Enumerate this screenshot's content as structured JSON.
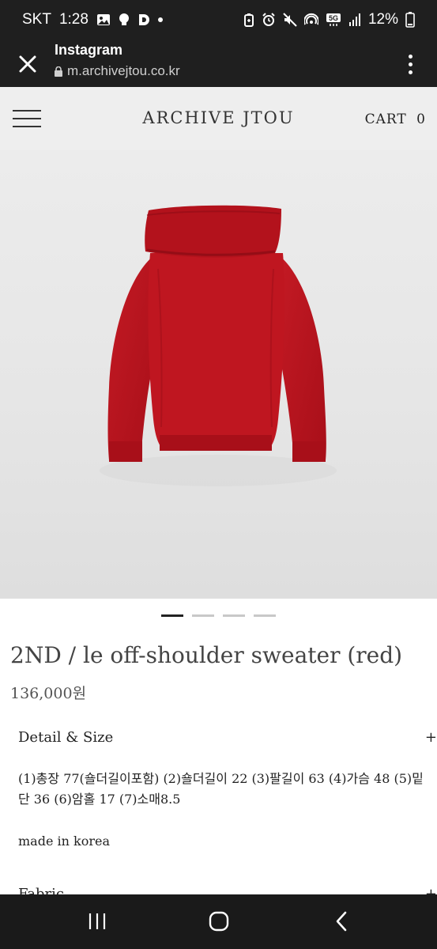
{
  "status_bar": {
    "carrier": "SKT",
    "time": "1:28",
    "notification_icons": [
      "gallery-icon",
      "bulb-icon",
      "d-app-icon",
      "more-dot-icon"
    ],
    "system_icons": [
      "battery-saver-icon",
      "alarm-icon",
      "mute-icon",
      "hotspot-icon",
      "5g-icon",
      "signal-icon"
    ],
    "network": "5G",
    "battery": "12%"
  },
  "browser": {
    "title": "Instagram",
    "url": "m.archivejtou.co.kr",
    "close_icon": "close-icon",
    "menu_icon": "more-vert-icon"
  },
  "site": {
    "logo": "ARCHIVE JTOU",
    "cart_label": "CART",
    "cart_count": "0"
  },
  "product": {
    "image_alt_color": "#b8141e",
    "carousel_count": 4,
    "carousel_active": 0,
    "title": "2ND / le off-shoulder sweater (red)",
    "price": "136,000원",
    "detail_heading": "Detail & Size",
    "detail_toggle": "+",
    "detail_line": "(1)총장 77(숄더길이포함) (2)숄더길이 22 (3)팔길이 63 (4)가슴 48 (5)밑단 36 (6)암홀 17 (7)소매8.5",
    "made_in": "made in korea",
    "fabric_heading": "Fabric",
    "fabric_toggle": "+"
  },
  "nav_bar": {
    "recent": "recent-apps-icon",
    "home": "home-icon",
    "back": "back-icon"
  },
  "colors": {
    "status_bg": "#1f1f1f",
    "site_header_bg": "#eeeeee",
    "sweater_red": "#b8141e",
    "text": "#333333"
  }
}
